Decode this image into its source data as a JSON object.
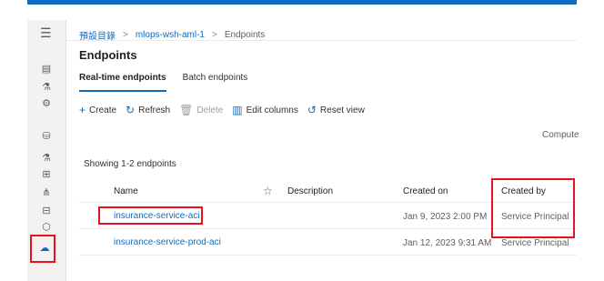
{
  "rail": {
    "menu_icon": "hamburger-icon",
    "items": [
      {
        "icon": "notebook-icon",
        "glyph": "▤"
      },
      {
        "icon": "automl-icon",
        "glyph": "⚗"
      },
      {
        "icon": "designer-icon",
        "glyph": "⚙"
      },
      {
        "icon": "data-icon",
        "glyph": "⛁"
      },
      {
        "icon": "jobs-icon",
        "glyph": "⚗"
      },
      {
        "icon": "components-icon",
        "glyph": "⊞"
      },
      {
        "icon": "pipelines-icon",
        "glyph": "⋔"
      },
      {
        "icon": "environments-icon",
        "glyph": "⊟"
      },
      {
        "icon": "models-icon",
        "glyph": "⬡"
      },
      {
        "icon": "endpoints-icon",
        "glyph": "☁"
      }
    ]
  },
  "breadcrumb": {
    "items": [
      "預設目錄",
      "mlops-wsh-aml-1",
      "Endpoints"
    ],
    "separator": ">"
  },
  "page": {
    "title": "Endpoints"
  },
  "tabs": [
    {
      "label": "Real-time endpoints",
      "active": true
    },
    {
      "label": "Batch endpoints",
      "active": false
    }
  ],
  "toolbar": {
    "create": "Create",
    "refresh": "Refresh",
    "delete": "Delete",
    "edit_columns": "Edit columns",
    "reset_view": "Reset view"
  },
  "compute_label": "Compute",
  "showing_text": "Showing 1-2 endpoints",
  "table": {
    "headers": {
      "name": "Name",
      "description": "Description",
      "created_on": "Created on",
      "created_by": "Created by"
    },
    "rows": [
      {
        "name": "insurance-service-aci",
        "created_on": "Jan 9, 2023 2:00 PM",
        "created_by": "Service Principal"
      },
      {
        "name": "insurance-service-prod-aci",
        "created_on": "Jan 12, 2023 9:31 AM",
        "created_by": "Service Principal"
      }
    ]
  },
  "colors": {
    "accent": "#0f6cbd",
    "highlight": "#e8111d"
  }
}
